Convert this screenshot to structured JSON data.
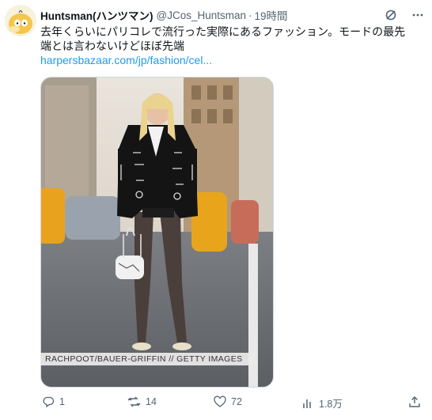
{
  "tweet": {
    "display_name": "Huntsman(ハンツマン)",
    "handle": "@JCos_Huntsman",
    "separator": "·",
    "time": "19時間",
    "text": "去年くらいにパリコレで流行った実際にあるファッション。モードの最先端とは言わないけどほぼ先端",
    "link_text": "harpersbazaar.com/jp/fashion/cel...",
    "media_credit": "RACHPOOT/BAUER-GRIFFIN // GETTY IMAGES"
  },
  "actions": {
    "replies": "1",
    "reposts": "14",
    "likes": "72",
    "views": "1.8万"
  },
  "colors": {
    "link": "#1d9bf0",
    "secondary_text": "#536471",
    "primary_text": "#0f1419",
    "border": "#cfd9de"
  },
  "icons": [
    "avatar-duck",
    "grok-icon",
    "more-icon",
    "reply-icon",
    "repost-icon",
    "like-icon",
    "views-icon",
    "share-icon"
  ]
}
